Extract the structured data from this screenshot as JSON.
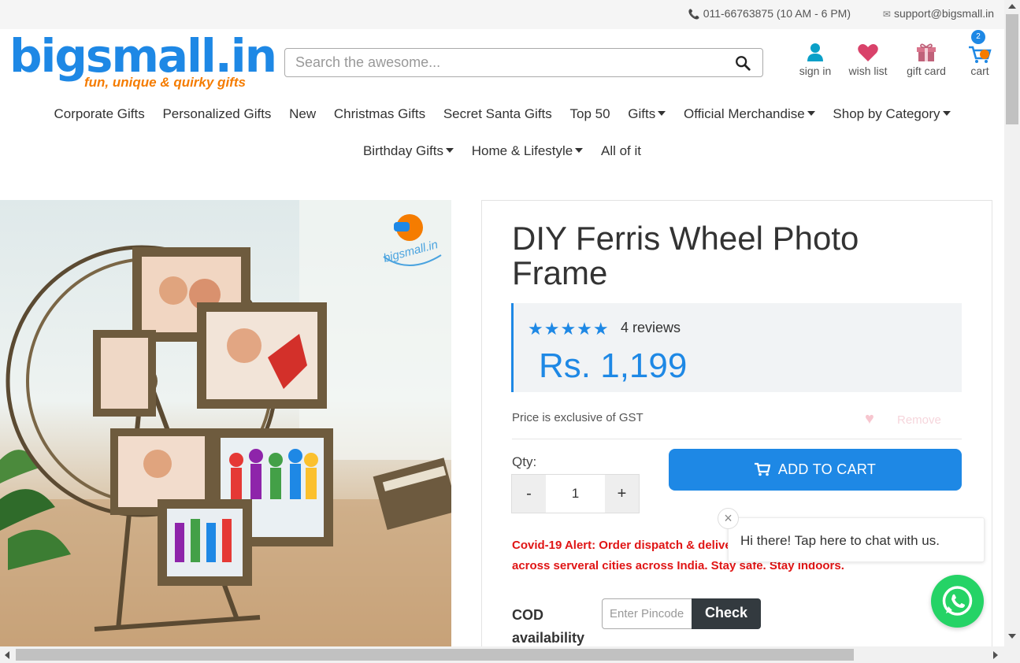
{
  "topbar": {
    "phone": "011-66763875 (10 AM - 6 PM)",
    "email": "support@bigsmall.in"
  },
  "logo": {
    "name": "bigsmall.in",
    "tagline": "fun, unique & quirky gifts"
  },
  "search": {
    "placeholder": "Search the awesome..."
  },
  "header_nav": {
    "sign_in": "sign in",
    "wish_list": "wish list",
    "gift_card": "gift card",
    "cart": "cart",
    "cart_count": "2"
  },
  "menu_row1": [
    "Corporate Gifts",
    "Personalized Gifts",
    "New",
    "Christmas Gifts",
    "Secret Santa Gifts",
    "Top 50",
    "Gifts",
    "Official Merchandise",
    "Shop by Category"
  ],
  "menu_row2": [
    "Birthday Gifts",
    "Home & Lifestyle",
    "All of it"
  ],
  "product": {
    "image_watermark": "bigsmall.in",
    "title": "DIY Ferris Wheel Photo Frame",
    "rating_stars": 5,
    "reviews": "4 reviews",
    "price": "Rs. 1,199",
    "gst_note": "Price is exclusive of GST",
    "remove_label": "Remove",
    "qty_label": "Qty:",
    "qty_minus": "-",
    "qty_value": "1",
    "qty_plus": "+",
    "add_to_cart": "ADD TO CART",
    "covid_alert": "Covid-19 Alert: Order dispatch & delivery may be delayed due to lockdown across serveral cities across India. Stay safe. Stay indoors.",
    "cod_label": "COD availability",
    "pincode_placeholder": "Enter Pincode",
    "check_label": "Check"
  },
  "chat": {
    "message": "Hi there! Tap here to chat with us.",
    "close": "×"
  },
  "colors": {
    "brand_blue": "#1e88e5",
    "brand_orange": "#f57c00",
    "alert_red": "#e01515",
    "whatsapp_green": "#25d366"
  }
}
